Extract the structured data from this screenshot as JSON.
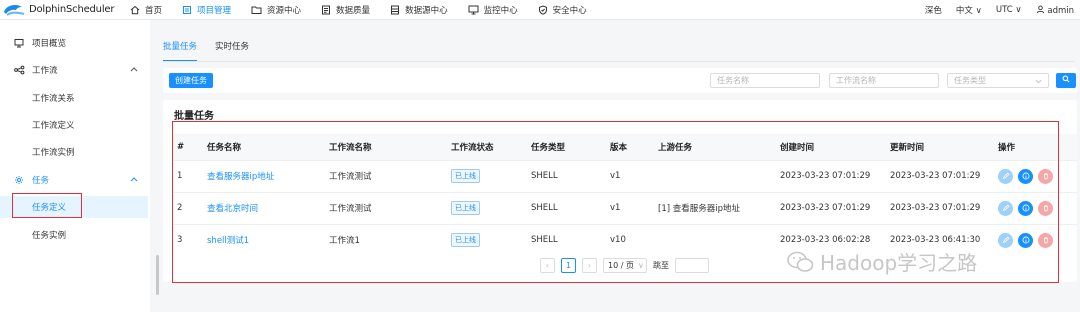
{
  "brand": {
    "name": "DolphinScheduler"
  },
  "nav": [
    {
      "label": "首页",
      "icon": "home-icon"
    },
    {
      "label": "项目管理",
      "icon": "project-icon",
      "active": true
    },
    {
      "label": "资源中心",
      "icon": "folder-icon"
    },
    {
      "label": "数据质量",
      "icon": "quality-icon"
    },
    {
      "label": "数据源中心",
      "icon": "datasource-icon"
    },
    {
      "label": "监控中心",
      "icon": "monitor-icon"
    },
    {
      "label": "安全中心",
      "icon": "shield-icon"
    }
  ],
  "top_right": {
    "theme": "深色",
    "language": "中文",
    "timezone": "UTC",
    "user": "admin"
  },
  "sidebar": {
    "items": [
      {
        "label": "项目概览",
        "icon": "overview-icon"
      },
      {
        "label": "工作流",
        "icon": "workflow-icon"
      },
      {
        "label": "工作流关系"
      },
      {
        "label": "工作流定义"
      },
      {
        "label": "工作流实例"
      },
      {
        "label": "任务",
        "icon": "gear-icon"
      },
      {
        "label": "任务定义"
      },
      {
        "label": "任务实例"
      }
    ]
  },
  "tabs": [
    {
      "label": "批量任务",
      "active": true
    },
    {
      "label": "实时任务"
    }
  ],
  "toolbar": {
    "create_label": "创建任务",
    "task_name_placeholder": "任务名称",
    "workflow_name_placeholder": "工作流名称",
    "task_type_placeholder": "任务类型"
  },
  "card": {
    "title": "批量任务"
  },
  "table": {
    "columns": [
      "#",
      "任务名称",
      "工作流名称",
      "工作流状态",
      "任务类型",
      "版本",
      "上游任务",
      "创建时间",
      "更新时间",
      "操作"
    ],
    "rows": [
      {
        "idx": "1",
        "name": "查看服务器ip地址",
        "workflow": "工作流测试",
        "status": "已上线",
        "type": "SHELL",
        "version": "v1",
        "upstream": "",
        "created": "2023-03-23 07:01:29",
        "updated": "2023-03-23 07:01:29"
      },
      {
        "idx": "2",
        "name": "查看北京时间",
        "workflow": "工作流测试",
        "status": "已上线",
        "type": "SHELL",
        "version": "v1",
        "upstream": "[1] 查看服务器ip地址",
        "created": "2023-03-23 07:01:29",
        "updated": "2023-03-23 07:01:29"
      },
      {
        "idx": "3",
        "name": "shell测试1",
        "workflow": "工作流1",
        "status": "已上线",
        "type": "SHELL",
        "version": "v10",
        "upstream": "",
        "created": "2023-03-23 06:02:28",
        "updated": "2023-03-23 06:41:30"
      }
    ]
  },
  "pagination": {
    "current": "1",
    "page_size": "10 / 页",
    "jump_label": "跳至"
  },
  "watermark": {
    "text": "Hadoop学习之路"
  }
}
